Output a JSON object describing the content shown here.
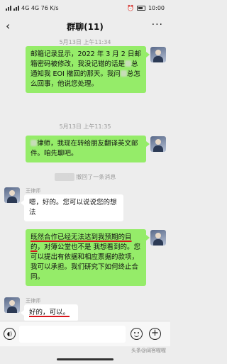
{
  "status": {
    "left_text": "4G 4G 76 K/s",
    "time": "10:00"
  },
  "header": {
    "back_icon": "chevron-left-icon",
    "title": "群聊(11)",
    "more_icon": "more-dots-icon"
  },
  "messages": [
    {
      "type": "timestamp",
      "text": "5月13日 上午11:34"
    },
    {
      "type": "me",
      "segments": [
        "邮箱记录显示，2022 年 3 月 2 日邮箱密码被修改，我没记错的话是",
        "总通知我 EOI 撤回的那天。我问",
        "总怎么回事，他说您处理。"
      ]
    },
    {
      "type": "timestamp",
      "text": "5月13日 上午11:35"
    },
    {
      "type": "me",
      "segments": [
        "律师，我现在转给朋友翻译英文邮件。咱先聊吧。"
      ]
    },
    {
      "type": "recall",
      "text": "撤回了一条消息"
    },
    {
      "type": "other",
      "sender": "王律师",
      "text": "嗯，好的。您可以说说您的想法"
    },
    {
      "type": "me",
      "underlined": "既然合作已经无法达到我预期的目的",
      "rest": "，对簿公堂也不是 我想看到的。您可以提出有依据和相应票据的款项，我可以承担。我们研究下如何终止合同。"
    },
    {
      "type": "other",
      "sender": "王律师",
      "underlined": "好的，可以。",
      "text": ""
    }
  ],
  "input": {
    "voice_icon": "voice-icon",
    "emoji_icon": "emoji-icon",
    "plus_icon": "plus-icon"
  },
  "watermark": "头条@阔客喔喔"
}
